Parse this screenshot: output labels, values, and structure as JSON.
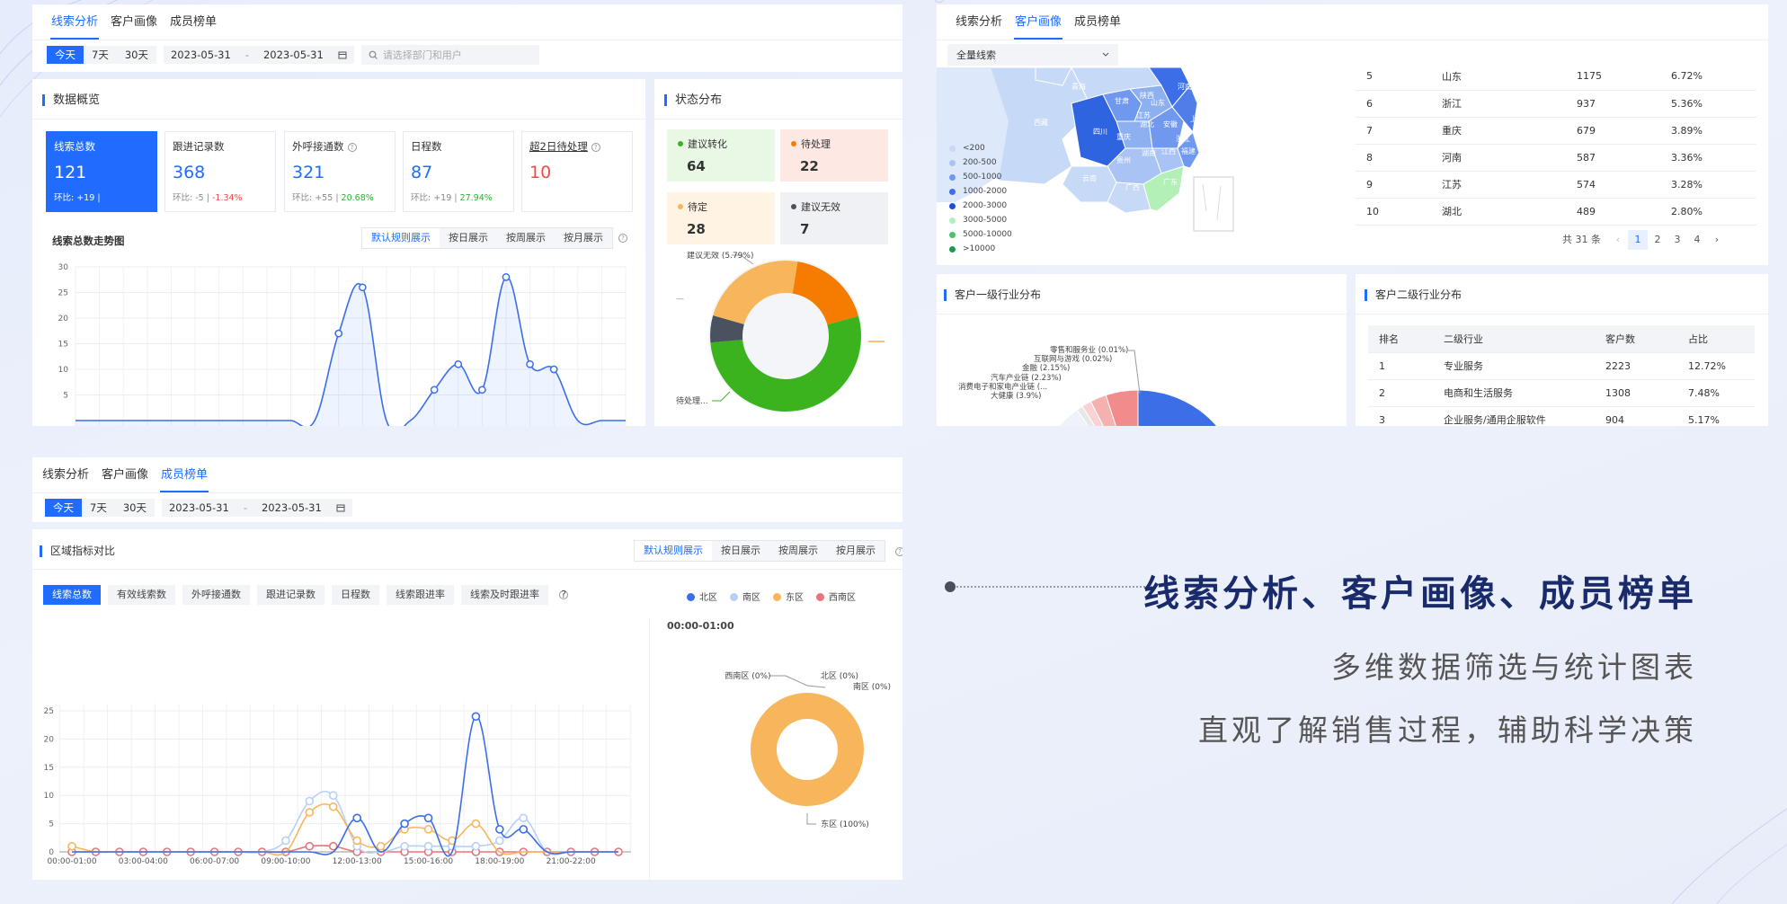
{
  "colors": {
    "primary": "#1f6cff",
    "green": "#3bb31e",
    "orange": "#f57c00",
    "dark": "#4a5260",
    "peach": "#f7b65c",
    "red": "#e8747c",
    "lightblue": "#b9d0f5"
  },
  "panel1": {
    "tabs": [
      "线索分析",
      "客户画像",
      "成员榜单"
    ],
    "active_tab": 0,
    "filter": {
      "periods": [
        "今天",
        "7天",
        "30天"
      ],
      "active_period": 0,
      "date_start": "2023-05-31",
      "date_sep": "-",
      "date_end": "2023-05-31",
      "search_placeholder": "请选择部门和用户"
    },
    "overview": {
      "title": "数据概览",
      "kpis": [
        {
          "label": "线索总数",
          "value": "121",
          "cmp_prefix": "环比: +19",
          "cmp_sep": "|",
          "cmp_pct": "",
          "selected": true
        },
        {
          "label": "跟进记录数",
          "value": "368",
          "cmp_prefix": "环比: -5",
          "cmp_sep": "|",
          "cmp_pct": "-1.34%",
          "dir": "down"
        },
        {
          "label": "外呼接通数",
          "value": "321",
          "cmp_prefix": "环比: +55",
          "cmp_sep": "|",
          "cmp_pct": "20.68%",
          "dir": "up",
          "help": "?"
        },
        {
          "label": "日程数",
          "value": "87",
          "cmp_prefix": "环比: +19",
          "cmp_sep": "|",
          "cmp_pct": "27.94%",
          "dir": "up"
        },
        {
          "label": "超2日待处理",
          "value": "10",
          "help": "?"
        }
      ],
      "trend_title": "线索总数走势图",
      "view_buttons": [
        "默认规则展示",
        "按日展示",
        "按周展示",
        "按月展示"
      ],
      "active_view": 0
    },
    "status": {
      "title": "状态分布",
      "items": [
        {
          "label": "建议转化",
          "value": "64",
          "dot": "#3bb31e",
          "bg": "#e9f8e4"
        },
        {
          "label": "待处理",
          "value": "22",
          "dot": "#f57c00",
          "bg": "#fde8e4"
        },
        {
          "label": "待定",
          "value": "28",
          "dot": "#f7b65c",
          "bg": "#fff4e3"
        },
        {
          "label": "建议无效",
          "value": "7",
          "dot": "#4a5260",
          "bg": "#f0f1f4"
        }
      ],
      "donut_labels": {
        "top": "建议无效 (5.79%)",
        "left": "—",
        "bottom_left": "待处理..."
      }
    }
  },
  "panel2": {
    "tabs": [
      "线索分析",
      "客户画像",
      "成员榜单"
    ],
    "active_tab": 1,
    "select": {
      "value": "全量线索"
    },
    "map_provinces": [
      "青海",
      "西藏",
      "四川",
      "重庆",
      "湖北",
      "安徽",
      "江苏",
      "山东",
      "河南",
      "陕西",
      "甘肃",
      "浙江",
      "湖南",
      "江西",
      "福建",
      "贵州",
      "云南",
      "广西",
      "广东",
      "上海"
    ],
    "map_legend": [
      "<200",
      "200-500",
      "500-1000",
      "1000-2000",
      "2000-3000",
      "3000-5000",
      "5000-10000",
      ">10000"
    ],
    "rank_rows": [
      [
        "5",
        "山东",
        "1175",
        "6.72%"
      ],
      [
        "6",
        "浙江",
        "937",
        "5.36%"
      ],
      [
        "7",
        "重庆",
        "679",
        "3.89%"
      ],
      [
        "8",
        "河南",
        "587",
        "3.36%"
      ],
      [
        "9",
        "江苏",
        "574",
        "3.28%"
      ],
      [
        "10",
        "湖北",
        "489",
        "2.80%"
      ]
    ],
    "pager": {
      "total": "共 31 条",
      "prev": "‹",
      "pages": [
        "1",
        "2",
        "3",
        "4"
      ],
      "active": "1",
      "next": "›"
    },
    "ind1": {
      "title": "客户一级行业分布",
      "labels": [
        "零售和服务业 (0.01%)",
        "互联网与游戏 (0.02%)",
        "金融 (2.15%)",
        "汽车产业链 (2.23%)",
        "消费电子和家电产业链 (...",
        "大健康 (3.9%)"
      ]
    },
    "ind2": {
      "title": "客户二级行业分布",
      "headers": [
        "排名",
        "二级行业",
        "客户数",
        "占比"
      ],
      "rows": [
        [
          "1",
          "专业服务",
          "2223",
          "12.72%"
        ],
        [
          "2",
          "电商和生活服务",
          "1308",
          "7.48%"
        ],
        [
          "3",
          "企业服务/通用企服软件",
          "904",
          "5.17%"
        ]
      ]
    }
  },
  "panel3": {
    "tabs": [
      "线索分析",
      "客户画像",
      "成员榜单"
    ],
    "active_tab": 2,
    "filter": {
      "periods": [
        "今天",
        "7天",
        "30天"
      ],
      "active_period": 0,
      "date_start": "2023-05-31",
      "date_sep": "-",
      "date_end": "2023-05-31"
    },
    "title": "区域指标对比",
    "view_buttons": [
      "默认规则展示",
      "按日展示",
      "按周展示",
      "按月展示"
    ],
    "active_view": 0,
    "metrics": [
      "线索总数",
      "有效线索数",
      "外呼接通数",
      "跟进记录数",
      "日程数",
      "线索跟进率",
      "线索及时跟进率"
    ],
    "active_metric": 0,
    "legend": [
      {
        "name": "北区",
        "color": "#3c6ee8"
      },
      {
        "name": "南区",
        "color": "#b9d0f5"
      },
      {
        "name": "东区",
        "color": "#f7b65c"
      },
      {
        "name": "西南区",
        "color": "#e8747c"
      }
    ],
    "pie_time": "00:00-01:00",
    "pie_labels": {
      "west": "西南区 (0%)",
      "north": "北区 (0%)",
      "south": "南区 (0%)",
      "east": "东区 (100%)"
    }
  },
  "promo": {
    "headline": "线索分析、客户画像、成员榜单",
    "line1": "多维数据筛选与统计图表",
    "line2": "直观了解销售过程，辅助科学决策"
  },
  "chart_data": [
    {
      "type": "line",
      "title": "线索总数走势图",
      "ylim": [
        0,
        30
      ],
      "yticks": [
        5,
        10,
        15,
        20,
        25,
        30
      ],
      "x": [
        0,
        1,
        2,
        3,
        4,
        5,
        6,
        7,
        8,
        9,
        10,
        11,
        12,
        13,
        14,
        15,
        16,
        17,
        18,
        19,
        20,
        21,
        22,
        23
      ],
      "series": [
        {
          "name": "线索总数",
          "values": [
            0,
            0,
            0,
            0,
            0,
            0,
            0,
            0,
            0,
            0,
            0,
            17,
            26,
            0,
            0,
            6,
            11,
            6,
            28,
            11,
            10,
            0,
            0,
            0
          ]
        }
      ]
    },
    {
      "type": "pie",
      "title": "状态分布",
      "series": [
        {
          "values": [
            {
              "name": "建议转化",
              "value": 64
            },
            {
              "name": "待处理",
              "value": 22
            },
            {
              "name": "待定",
              "value": 28
            },
            {
              "name": "建议无效",
              "value": 7
            }
          ]
        }
      ]
    },
    {
      "type": "line",
      "title": "区域指标对比",
      "ylim": [
        0,
        25
      ],
      "yticks": [
        0,
        5,
        10,
        15,
        20,
        25
      ],
      "categories": [
        "00:00-01:00",
        "01:00-02:00",
        "02:00-03:00",
        "03:00-04:00",
        "04:00-05:00",
        "05:00-06:00",
        "06:00-07:00",
        "07:00-08:00",
        "08:00-09:00",
        "09:00-10:00",
        "10:00-11:00",
        "11:00-12:00",
        "12:00-13:00",
        "13:00-14:00",
        "14:00-15:00",
        "15:00-16:00",
        "16:00-17:00",
        "17:00-18:00",
        "18:00-19:00",
        "19:00-20:00",
        "20:00-21:00",
        "21:00-22:00",
        "22:00-23:00",
        "23:00-24:00"
      ],
      "xtick_labels": [
        "00:00-01:00",
        "03:00-04:00",
        "06:00-07:00",
        "09:00-10:00",
        "12:00-13:00",
        "15:00-16:00",
        "18:00-19:00",
        "21:00-22:00"
      ],
      "series": [
        {
          "name": "北区",
          "values": [
            0,
            0,
            0,
            0,
            0,
            0,
            0,
            0,
            0,
            0,
            0,
            0,
            6,
            0,
            5,
            6,
            0,
            24,
            4,
            4,
            0,
            0,
            0,
            0
          ]
        },
        {
          "name": "南区",
          "values": [
            0,
            0,
            0,
            0,
            0,
            0,
            0,
            0,
            0,
            2,
            9,
            10,
            1,
            0,
            1,
            1,
            1,
            1,
            2,
            6,
            0,
            0,
            0,
            0
          ]
        },
        {
          "name": "东区",
          "values": [
            1,
            0,
            0,
            0,
            0,
            0,
            0,
            0,
            0,
            0,
            7,
            8,
            2,
            1,
            4,
            4,
            2,
            5,
            0,
            0,
            0,
            0,
            0,
            0
          ]
        },
        {
          "name": "西南区",
          "values": [
            0,
            0,
            0,
            0,
            0,
            0,
            0,
            0,
            0,
            0,
            1,
            1,
            0,
            0,
            0,
            0,
            0,
            0,
            0,
            0,
            0,
            0,
            0,
            0
          ]
        }
      ]
    },
    {
      "type": "pie",
      "title": "00:00-01:00",
      "series": [
        {
          "values": [
            {
              "name": "西南区",
              "value": 0
            },
            {
              "name": "北区",
              "value": 0
            },
            {
              "name": "南区",
              "value": 0
            },
            {
              "name": "东区",
              "value": 100
            }
          ]
        }
      ]
    }
  ]
}
